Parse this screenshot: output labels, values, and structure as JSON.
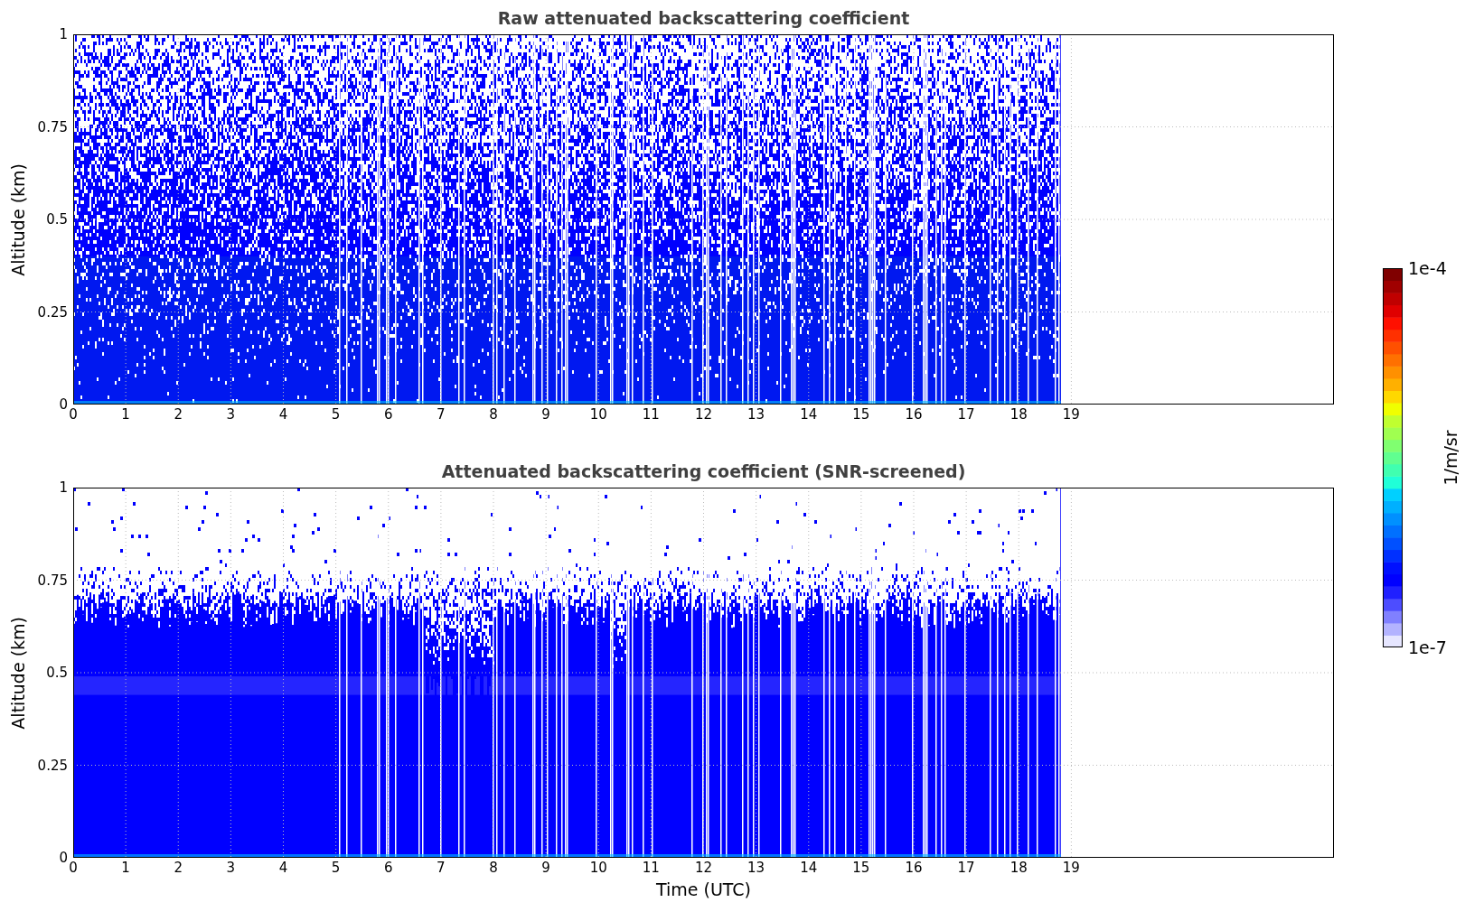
{
  "panels": [
    {
      "kind": "raw",
      "title": "Raw attenuated backscattering coefficient",
      "ylabel": "Altitude (km)",
      "yticks": [
        "1",
        "0.75",
        "0.5",
        "0.25",
        "0"
      ],
      "xticks": [
        "0",
        "1",
        "2",
        "3",
        "4",
        "5",
        "6",
        "7",
        "8",
        "9",
        "10",
        "11",
        "12",
        "13",
        "14",
        "15",
        "16",
        "17",
        "18",
        "19"
      ]
    },
    {
      "kind": "screened",
      "title": "Attenuated backscattering coefficient (SNR-screened)",
      "ylabel": "Altitude (km)",
      "yticks": [
        "1",
        "0.75",
        "0.5",
        "0.25",
        "0"
      ],
      "xticks": [
        "0",
        "1",
        "2",
        "3",
        "4",
        "5",
        "6",
        "7",
        "8",
        "9",
        "10",
        "11",
        "12",
        "13",
        "14",
        "15",
        "16",
        "17",
        "18",
        "19"
      ],
      "xlabel": "Time (UTC)"
    }
  ],
  "colorbar": {
    "max_label": "1e-4",
    "min_label": "1e-7",
    "unit": "1/m/sr"
  }
}
